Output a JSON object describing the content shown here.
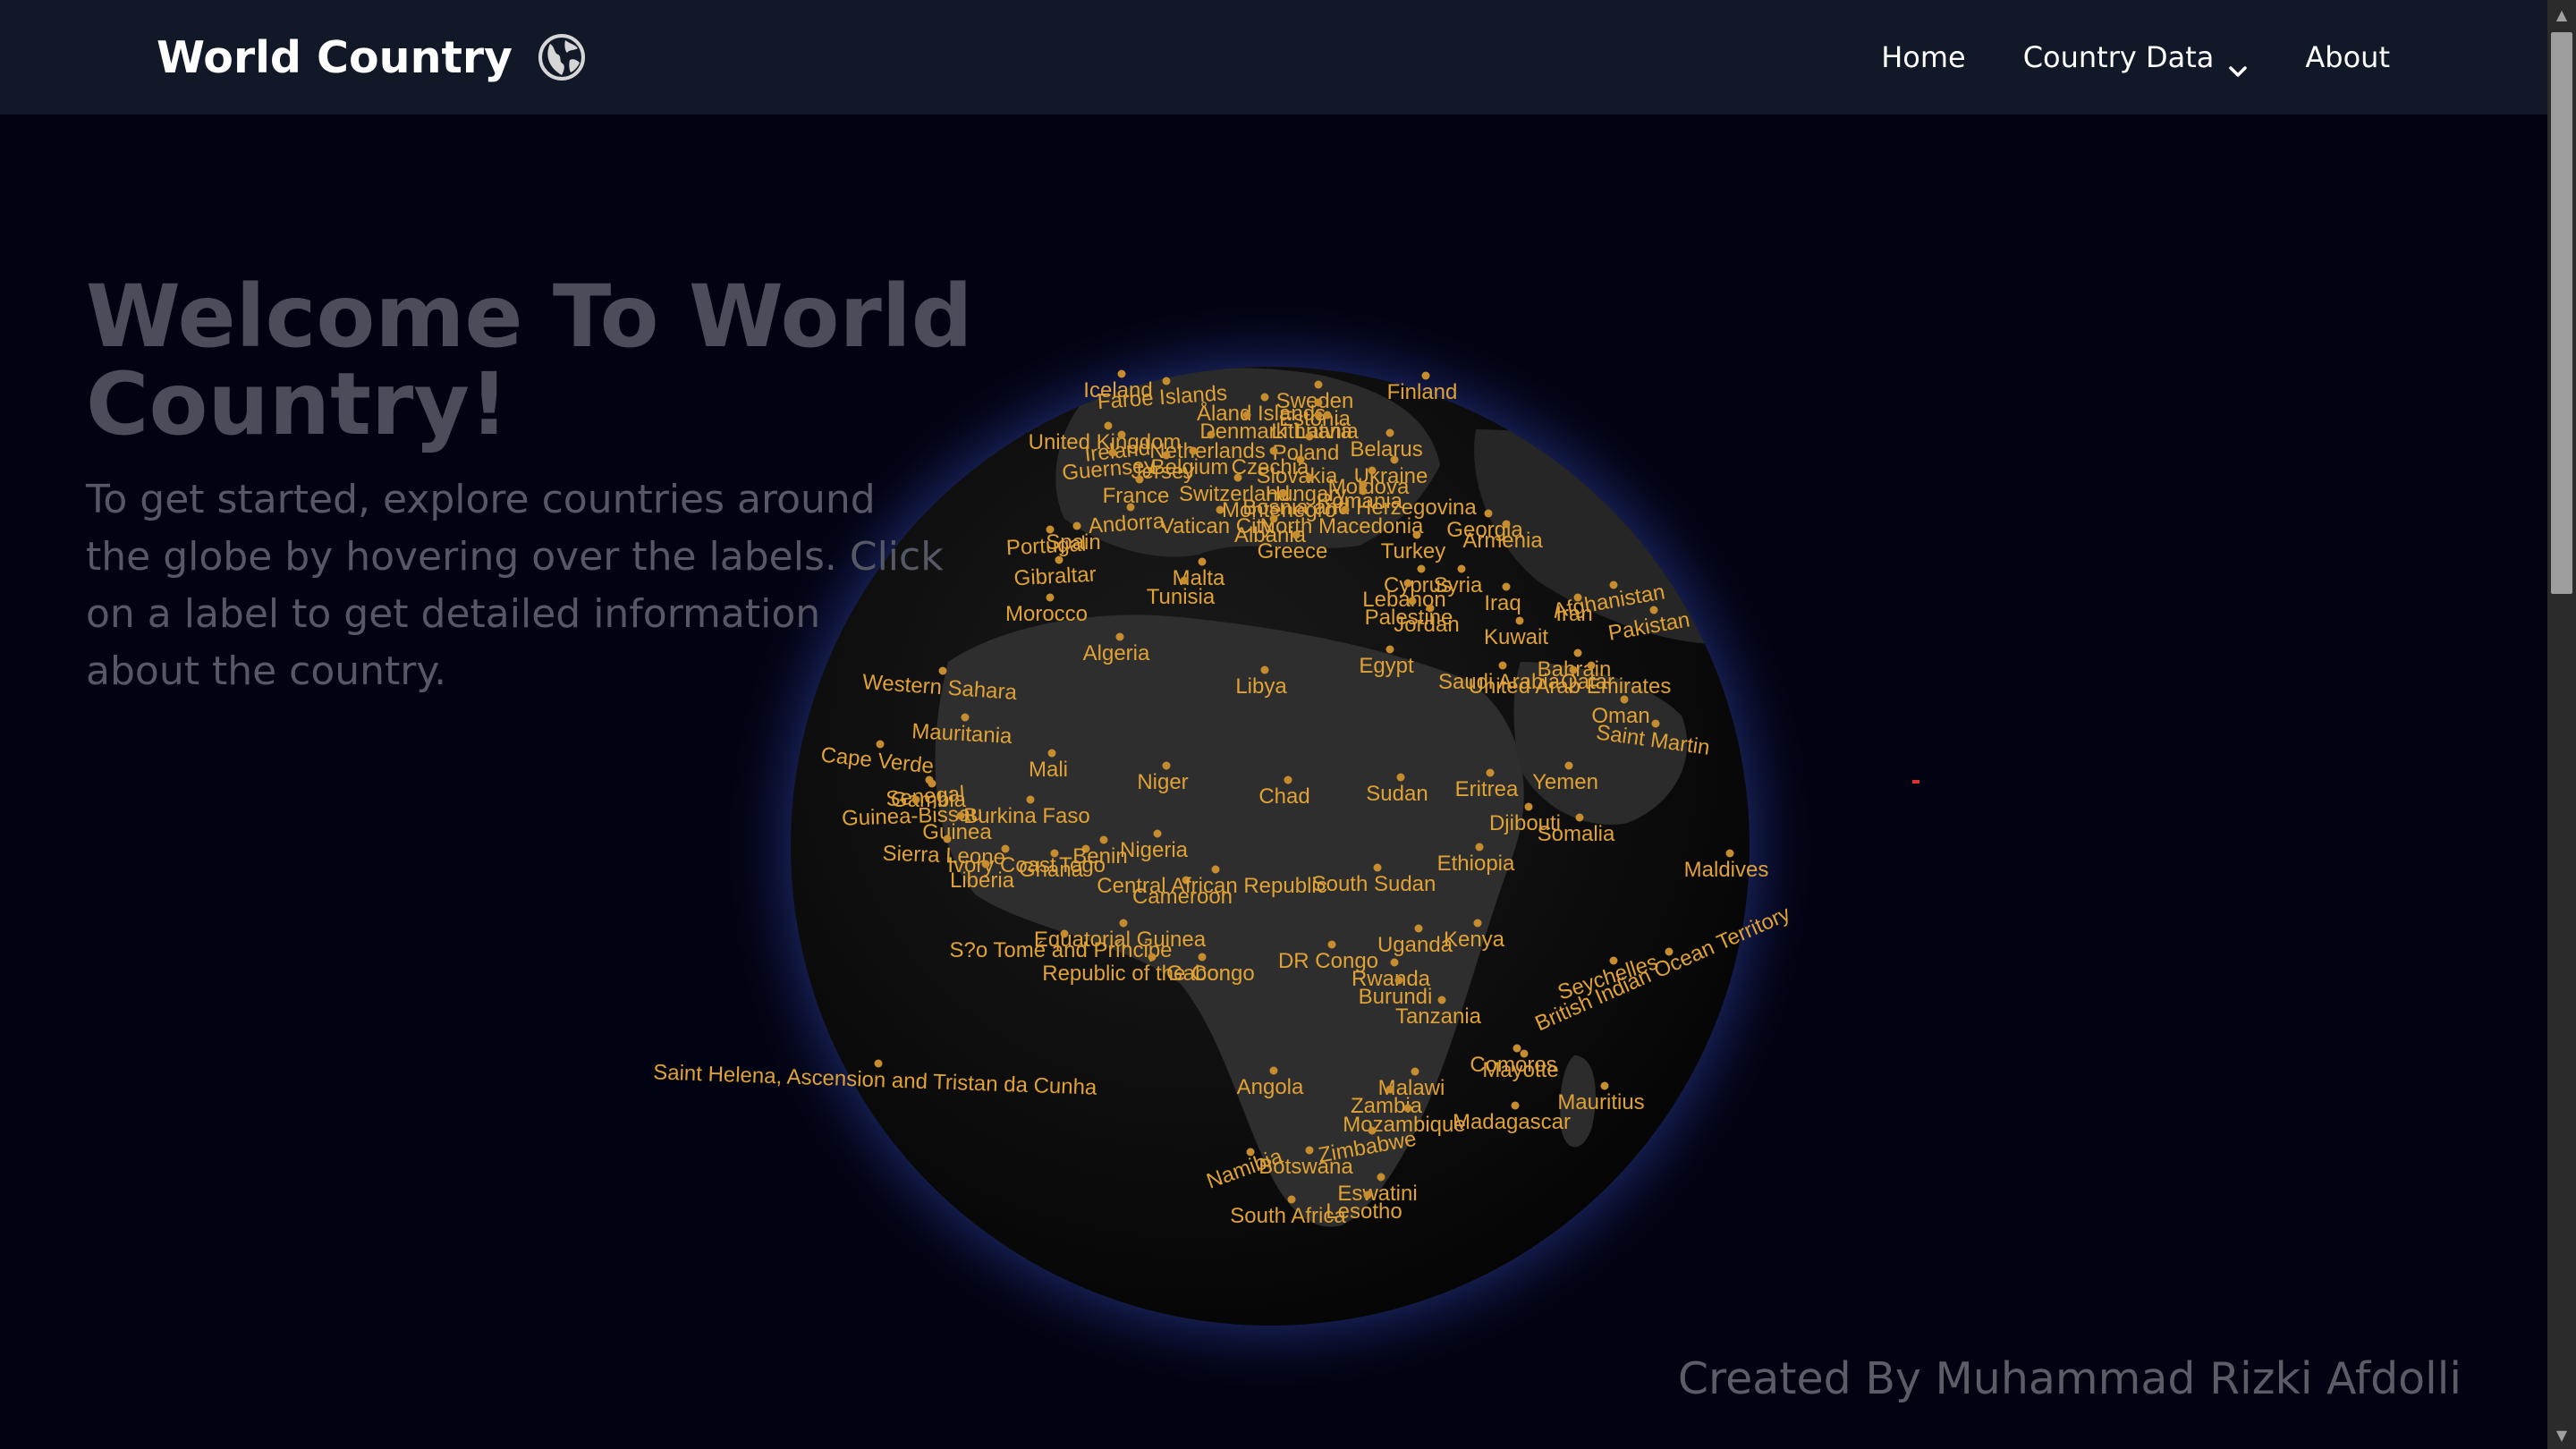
{
  "navbar": {
    "brand_title": "World Country",
    "brand_icon": "globe-icon",
    "links": [
      {
        "label": "Home"
      },
      {
        "label": "Country Data",
        "icon": "chevron-down-icon"
      },
      {
        "label": "About"
      }
    ]
  },
  "hero": {
    "title": "Welcome To World Country!",
    "description": "To get started, explore countries around the globe by hovering over the labels. Click on a label to get detailed information about the country."
  },
  "footer": {
    "credit": "Created By Muhammad Rizki Afdolli"
  },
  "colors": {
    "navbar_bg": "#111827",
    "page_bg": "#020312",
    "label_color": "#e0a235",
    "globe_glow": "#2a3b8f"
  },
  "globe_labels": [
    "Finland",
    "Faroe Islands",
    "Sweden",
    "Iceland",
    "Åland Islands",
    "Estonia",
    "Latvia",
    "Denmark",
    "Lithuania",
    "United Kingdom",
    "Ireland",
    "Netherlands",
    "Poland",
    "Belarus",
    "Guernsey",
    "Jersey",
    "Belgium",
    "Czechia",
    "Slovakia",
    "Ukraine",
    "Moldova",
    "Romania",
    "France",
    "Switzerland",
    "Hungary",
    "Bosnia and Herzegovina",
    "Andorra",
    "Vatican City",
    "Montenegro",
    "North Macedonia",
    "Portugal",
    "Spain",
    "Albania",
    "Greece",
    "Turkey",
    "Georgia",
    "Armenia",
    "Gibraltar",
    "Malta",
    "Cyprus",
    "Syria",
    "Lebanon",
    "Iraq",
    "Iran",
    "Afghanistan",
    "Palestine",
    "Jordan",
    "Pakistan",
    "Tunisia",
    "Morocco",
    "Kuwait",
    "Algeria",
    "Egypt",
    "Bahrain",
    "Qatar",
    "Saudi Arabia",
    "United Arab Emirates",
    "Oman",
    "Western Sahara",
    "Libya",
    "Mauritania",
    "Saint Martin",
    "Cape Verde",
    "Mali",
    "Niger",
    "Chad",
    "Sudan",
    "Eritrea",
    "Yemen",
    "Senegal",
    "Gambia",
    "Guinea-Bissau",
    "Burkina Faso",
    "Djibouti",
    "Guinea",
    "Somalia",
    "Sierra Leone",
    "Ivory Coast",
    "Ghana",
    "Togo",
    "Benin",
    "Nigeria",
    "Liberia",
    "Ethiopia",
    "Cameroon",
    "Central African Republic",
    "South Sudan",
    "Equatorial Guinea",
    "Uganda",
    "Kenya",
    "S?o Tomé and Príncipe",
    "DR Congo",
    "Gabon",
    "Republic of the Congo",
    "Rwanda",
    "Burundi",
    "Seychelles",
    "British Indian Ocean Territory",
    "Tanzania",
    "Comoros",
    "Mayotte",
    "Saint Helena, Ascension and Tristan da Cunha",
    "Angola",
    "Malawi",
    "Zambia",
    "Madagascar",
    "Mauritius",
    "Mozambique",
    "Zimbabwe",
    "Namibia",
    "Botswana",
    "Eswatini",
    "South Africa",
    "Lesotho",
    "Maldives"
  ]
}
